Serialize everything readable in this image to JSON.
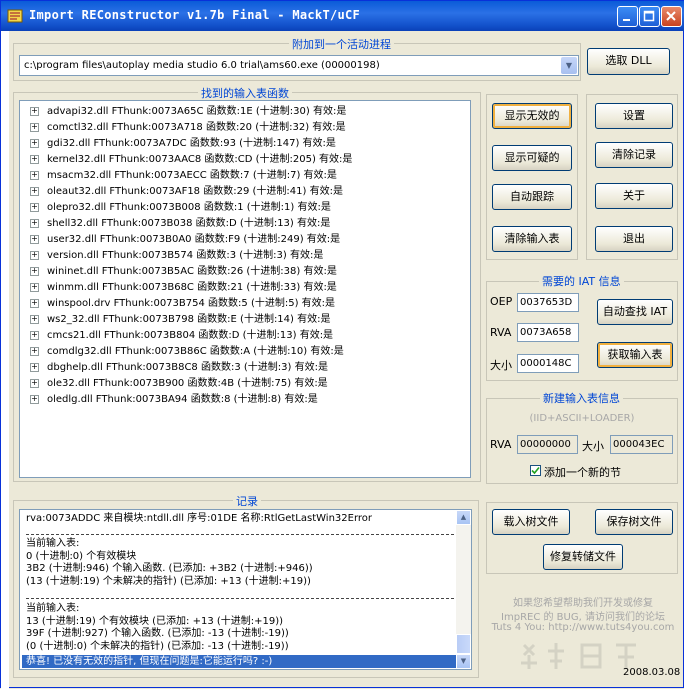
{
  "window": {
    "title": "Import REConstructor v1.7b Final - MackT/uCF"
  },
  "process_group": {
    "label": "附加到一个活动进程",
    "selected_process": "c:\\program files\\autoplay media studio 6.0 trial\\ams60.exe (00000198)",
    "pick_dll_button": "选取 DLL"
  },
  "imports_group": {
    "label": "找到的输入表函数",
    "items": [
      "advapi32.dll FThunk:0073A65C 函数数:1E (十进制:30) 有效:是",
      "comctl32.dll FThunk:0073A718 函数数:20 (十进制:32) 有效:是",
      "gdi32.dll FThunk:0073A7DC 函数数:93 (十进制:147) 有效:是",
      "kernel32.dll FThunk:0073AAC8 函数数:CD (十进制:205) 有效:是",
      "msacm32.dll FThunk:0073AECC 函数数:7 (十进制:7) 有效:是",
      "oleaut32.dll FThunk:0073AF18 函数数:29 (十进制:41) 有效:是",
      "olepro32.dll FThunk:0073B008 函数数:1 (十进制:1) 有效:是",
      "shell32.dll FThunk:0073B038 函数数:D (十进制:13) 有效:是",
      "user32.dll FThunk:0073B0A0 函数数:F9 (十进制:249) 有效:是",
      "version.dll FThunk:0073B574 函数数:3 (十进制:3) 有效:是",
      "wininet.dll FThunk:0073B5AC 函数数:26 (十进制:38) 有效:是",
      "winmm.dll FThunk:0073B68C 函数数:21 (十进制:33) 有效:是",
      "winspool.drv FThunk:0073B754 函数数:5 (十进制:5) 有效:是",
      "ws2_32.dll FThunk:0073B798 函数数:E (十进制:14) 有效:是",
      "cmcs21.dll FThunk:0073B804 函数数:D (十进制:13) 有效:是",
      "comdlg32.dll FThunk:0073B86C 函数数:A (十进制:10) 有效:是",
      "dbghelp.dll FThunk:0073B8C8 函数数:3 (十进制:3) 有效:是",
      "ole32.dll FThunk:0073B900 函数数:4B (十进制:75) 有效:是",
      "oledlg.dll FThunk:0073BA94 函数数:8 (十进制:8) 有效:是"
    ]
  },
  "action_buttons": {
    "show_invalid": "显示无效的",
    "show_suspect": "显示可疑的",
    "auto_trace": "自动跟踪",
    "clear_imports": "清除输入表",
    "settings": "设置",
    "clear_log": "清除记录",
    "about": "关于",
    "exit": "退出"
  },
  "iat_group": {
    "label": "需要的 IAT 信息",
    "oep_label": "OEP",
    "oep_value": "0037653D",
    "rva_label": "RVA",
    "rva_value": "0073A658",
    "size_label": "大小",
    "size_value": "0000148C",
    "iat_autosearch_button": "自动查找 IAT",
    "get_imports_button": "获取输入表"
  },
  "new_import_group": {
    "label": "新建输入表信息",
    "hint": "(IID+ASCII+LOADER)",
    "rva_label": "RVA",
    "rva_value": "00000000",
    "size_label": "大小",
    "size_value": "000043EC",
    "add_section_checkbox": "添加一个新的节",
    "add_section_checked": true
  },
  "log_group": {
    "label": "记录",
    "lines": [
      {
        "text": "rva:0073ADDC 来自模块:ntdll.dll 序号:01DE 名称:RtlGetLastWin32Error",
        "type": "line"
      },
      {
        "text": "",
        "type": "sep"
      },
      {
        "text": "当前输入表:",
        "type": "line"
      },
      {
        "text": "0 (十进制:0) 个有效模块",
        "type": "line"
      },
      {
        "text": "3B2 (十进制:946) 个输入函数. (已添加: +3B2 (十进制:+946))",
        "type": "line"
      },
      {
        "text": "(13 (十进制:19) 个未解决的指针) (已添加: +13 (十进制:+19))",
        "type": "line"
      },
      {
        "text": "",
        "type": "sep"
      },
      {
        "text": "当前输入表:",
        "type": "line"
      },
      {
        "text": "13 (十进制:19) 个有效模块 (已添加: +13 (十进制:+19))",
        "type": "line"
      },
      {
        "text": "39F (十进制:927) 个输入函数. (已添加: -13 (十进制:-19))",
        "type": "line"
      },
      {
        "text": "(0 (十进制:0) 个未解决的指针) (已添加: -13 (十进制:-19))",
        "type": "line"
      },
      {
        "text": "恭喜! 已没有无效的指针, 但现在问题是:它能运行吗? :-)",
        "type": "selected"
      }
    ]
  },
  "tree_buttons": {
    "load_tree": "载入树文件",
    "save_tree": "保存树文件",
    "fix_dump": "修复转储文件"
  },
  "footer": {
    "hint_line1": "如果您希望帮助我们开发或修复",
    "hint_line2": "ImpREC 的 BUG, 请访问我们的论坛",
    "hint_line3": "Tuts 4 You: http://www.tuts4you.com",
    "date": "2008.03.08"
  },
  "colors": {
    "title_bar": "#0a5bd8",
    "group_label": "#0046d5",
    "selection": "#316ac5"
  }
}
